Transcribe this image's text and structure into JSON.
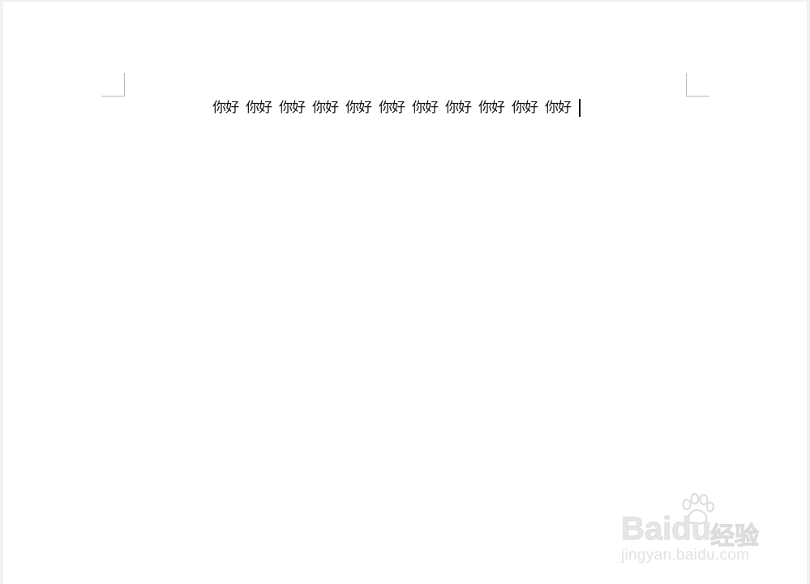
{
  "document": {
    "words": [
      "你好",
      "你好",
      "你好",
      "你好",
      "你好",
      "你好",
      "你好",
      "你好",
      "你好",
      "你好",
      "你好"
    ]
  },
  "watermark": {
    "logo_text": "Baidu",
    "logo_cn": "经验",
    "url": "jingyan.baidu.com",
    "icon": "baidu-paw-icon"
  }
}
